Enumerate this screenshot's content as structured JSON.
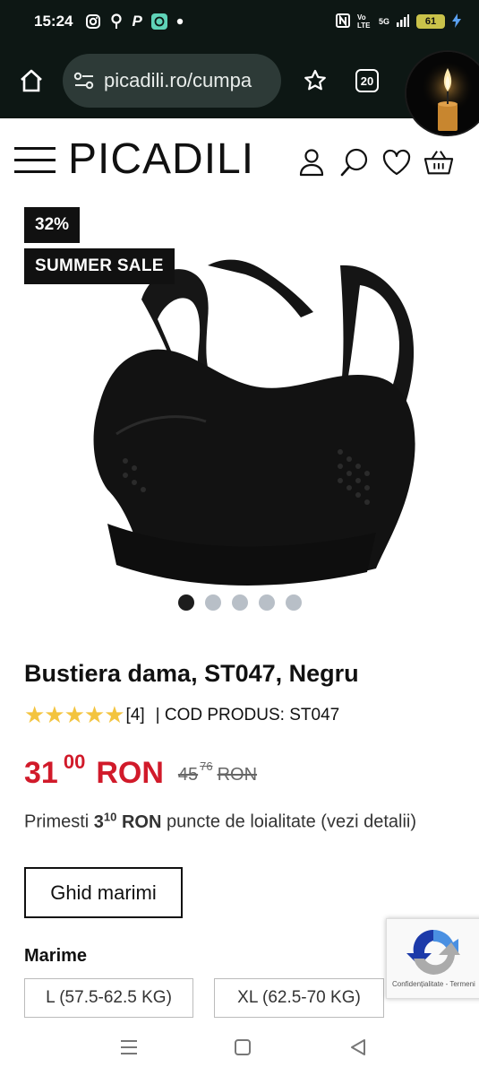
{
  "status_bar": {
    "time": "15:24",
    "network_label": "5G",
    "volte_label": "Vo LTE",
    "battery": "61"
  },
  "browser": {
    "url": "picadili.ro/cumpa",
    "tab_count": "20"
  },
  "site": {
    "logo": "PICADILI"
  },
  "gallery": {
    "discount_badge": "32%",
    "sale_badge": "SUMMER SALE",
    "image_count": 5,
    "active_image": 1
  },
  "product": {
    "title": "Bustiera dama, ST047, Negru",
    "stars": "★★★★★",
    "reviews": "[4]",
    "sku": "| COD PRODUS: ST047",
    "price_int": "31",
    "price_dec": "00",
    "currency": "RON",
    "old_price_int": "45",
    "old_price_dec": "76",
    "old_currency": "RON",
    "loyalty_prefix": "Primesti ",
    "loyalty_int": "3",
    "loyalty_dec": "10",
    "loyalty_currency": " RON",
    "loyalty_suffix": " puncte de loialitate (vezi detalii)",
    "size_guide_label": "Ghid marimi",
    "size_label": "Marime",
    "sizes": [
      "L (57.5-62.5 KG)",
      "XL (62.5-70 KG)"
    ]
  },
  "recaptcha": {
    "footer": "Confidențialitate - Termeni"
  },
  "colors": {
    "price_red": "#d11a2a",
    "star_yellow": "#f3c43f",
    "browser_bg": "#0d1714"
  }
}
